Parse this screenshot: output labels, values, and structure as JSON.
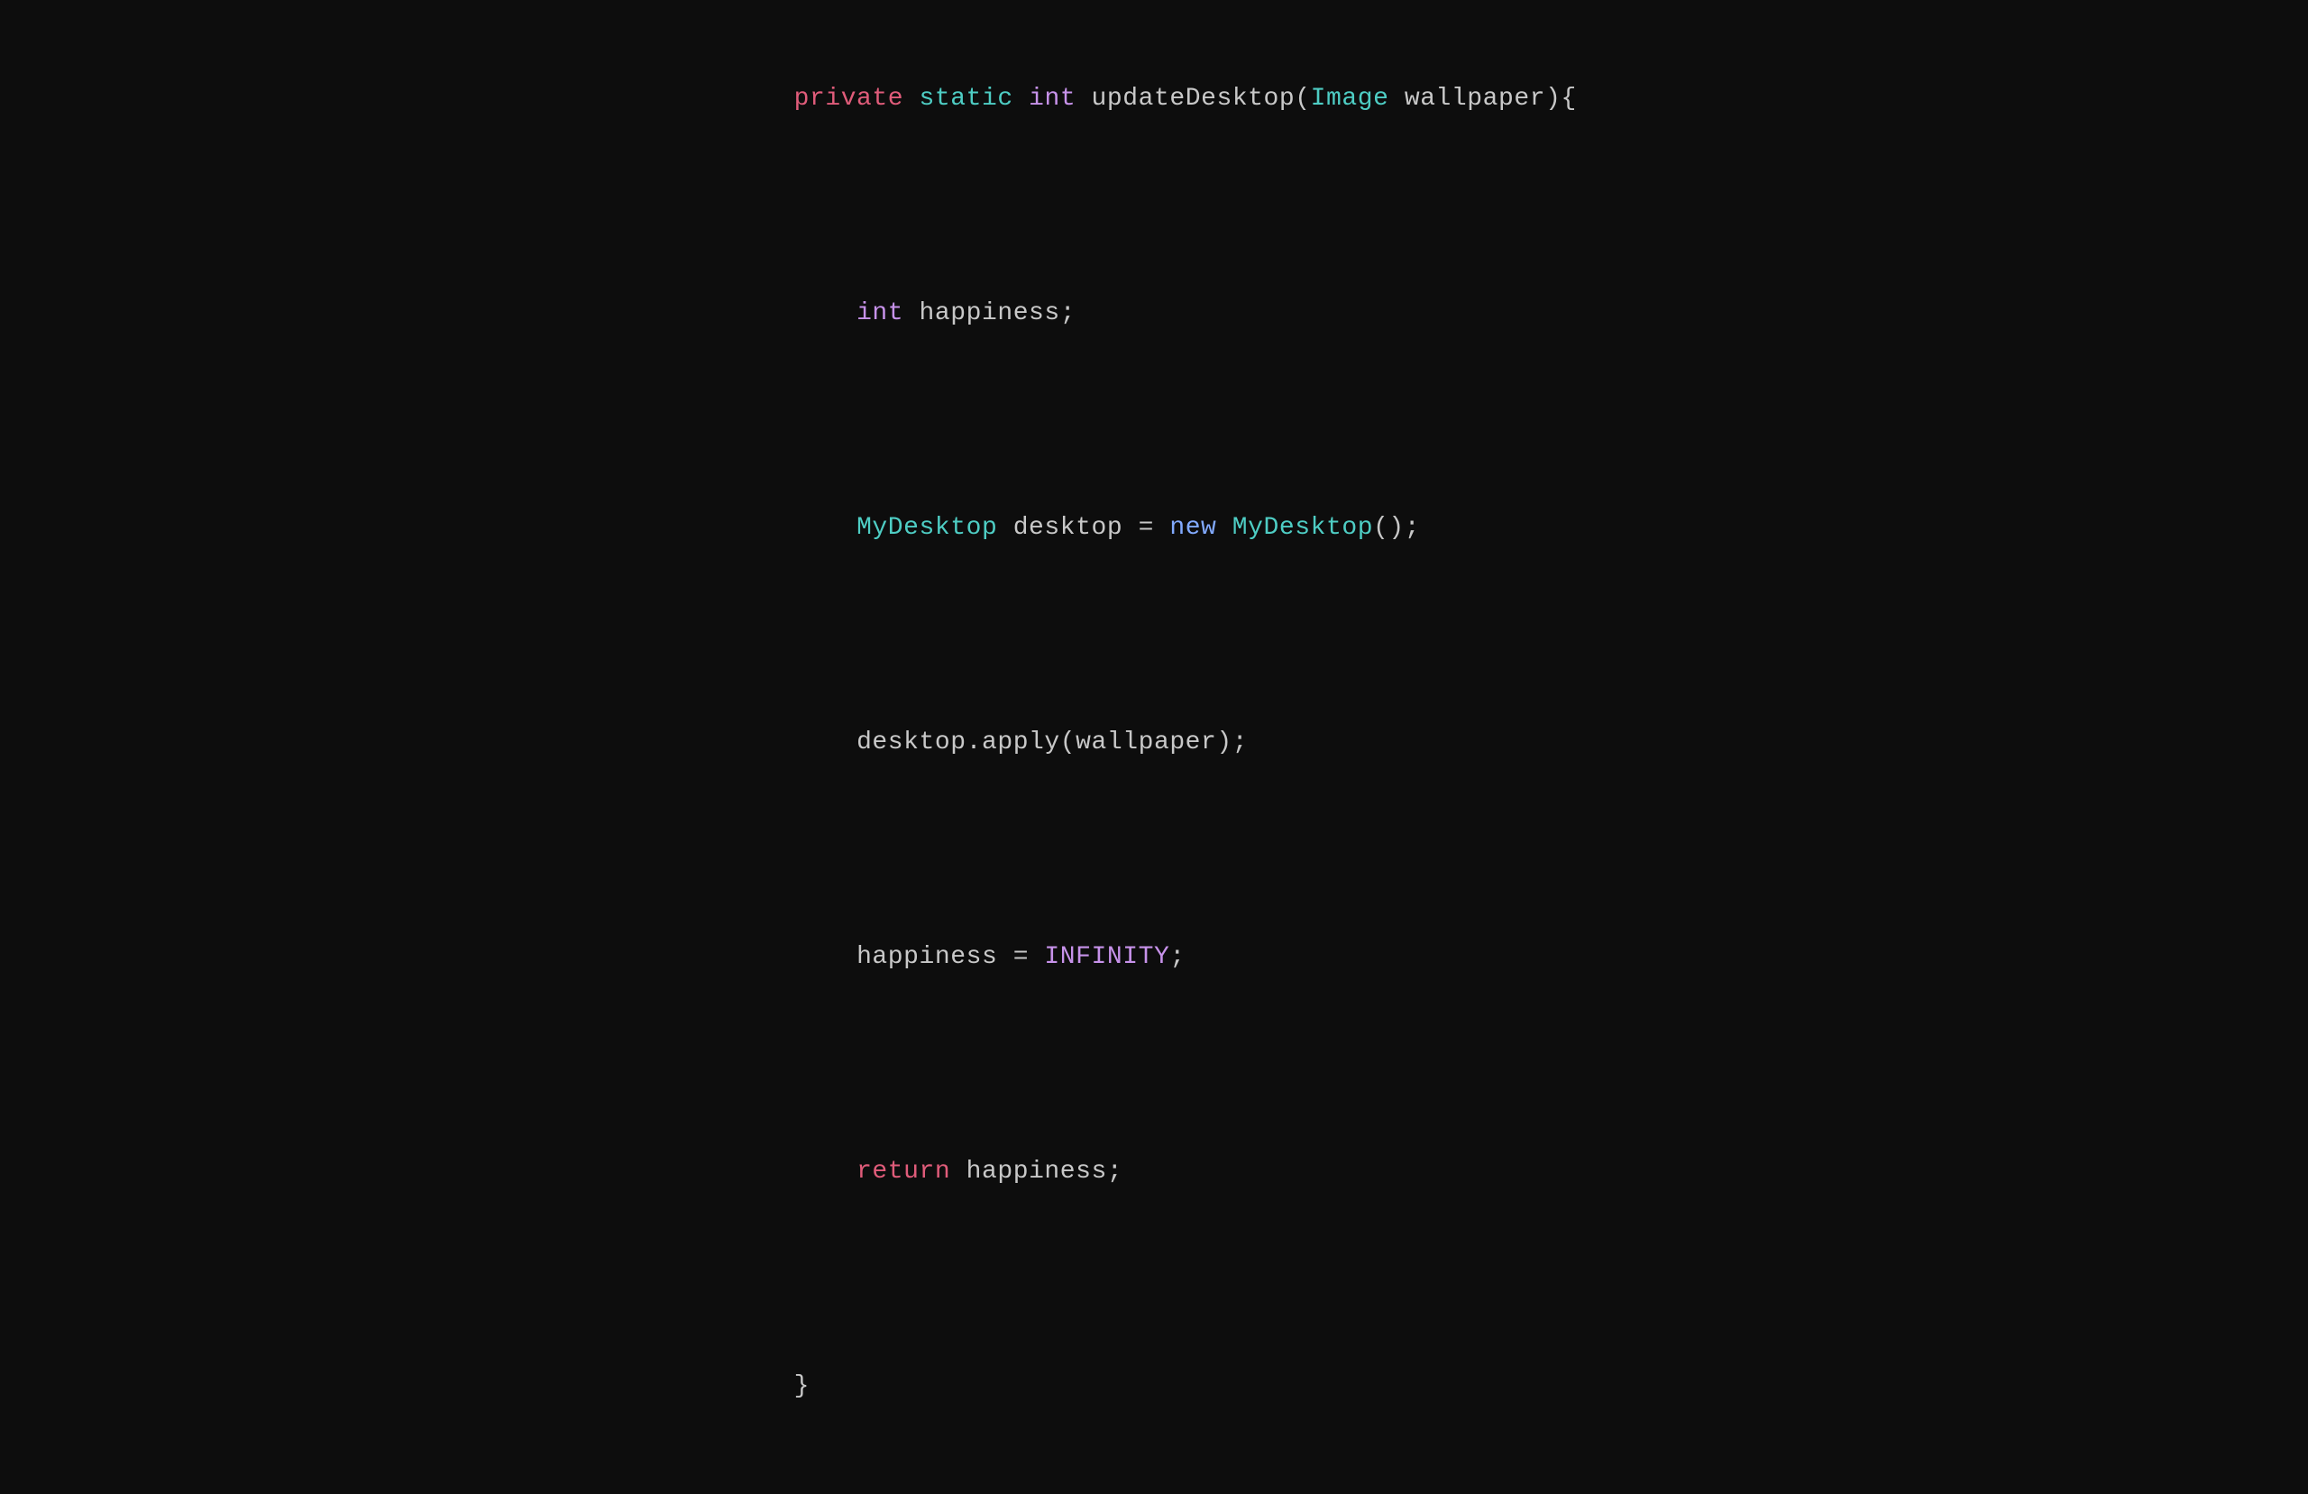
{
  "code": {
    "line1": {
      "parts": [
        {
          "text": "private",
          "class": "keyword-private"
        },
        {
          "text": " ",
          "class": "default-text"
        },
        {
          "text": "static",
          "class": "keyword-static"
        },
        {
          "text": " ",
          "class": "default-text"
        },
        {
          "text": "int",
          "class": "keyword-int"
        },
        {
          "text": " updateDesktop(",
          "class": "default-text"
        },
        {
          "text": "Image",
          "class": "param-type"
        },
        {
          "text": " wallpaper){",
          "class": "default-text"
        }
      ]
    },
    "line2": {
      "indent": "    ",
      "parts": [
        {
          "text": "int",
          "class": "keyword-int"
        },
        {
          "text": " happiness;",
          "class": "default-text"
        }
      ]
    },
    "line3": {
      "indent": "    ",
      "parts": [
        {
          "text": "MyDesktop",
          "class": "class-name"
        },
        {
          "text": " desktop = ",
          "class": "default-text"
        },
        {
          "text": "new",
          "class": "keyword-new"
        },
        {
          "text": " ",
          "class": "default-text"
        },
        {
          "text": "MyDesktop",
          "class": "class-name"
        },
        {
          "text": "();",
          "class": "default-text"
        }
      ]
    },
    "line4": {
      "indent": "    ",
      "parts": [
        {
          "text": "desktop.apply(wallpaper);",
          "class": "default-text"
        }
      ]
    },
    "line5": {
      "indent": "    ",
      "parts": [
        {
          "text": "happiness = ",
          "class": "default-text"
        },
        {
          "text": "INFINITY",
          "class": "constant"
        },
        {
          "text": ";",
          "class": "default-text"
        }
      ]
    },
    "line6": {
      "indent": "    ",
      "parts": [
        {
          "text": "return",
          "class": "keyword-return"
        },
        {
          "text": " happiness;",
          "class": "default-text"
        }
      ]
    },
    "line7": {
      "parts": [
        {
          "text": "}",
          "class": "default-text"
        }
      ]
    }
  }
}
